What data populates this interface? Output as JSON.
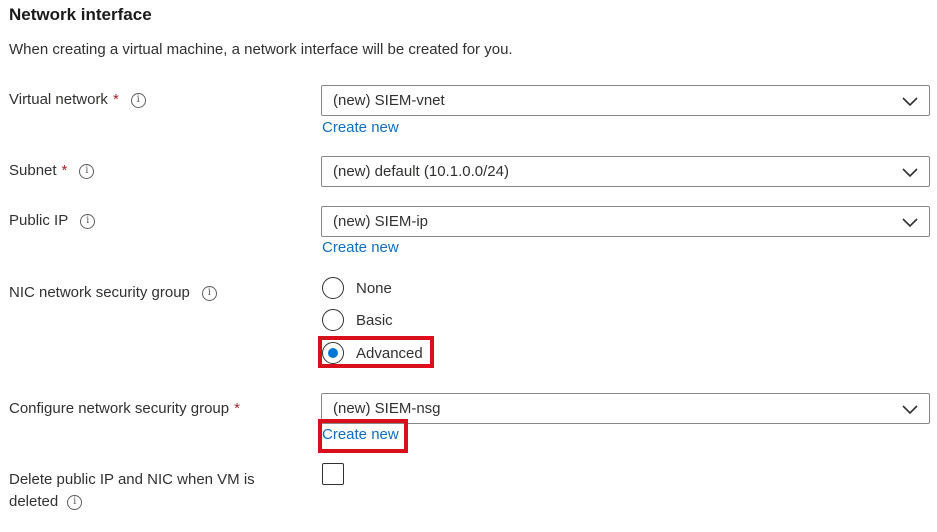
{
  "section": {
    "title": "Network interface",
    "description": "When creating a virtual machine, a network interface will be created for you."
  },
  "fields": {
    "virtual_network": {
      "label": "Virtual network",
      "required": "*",
      "value": "(new) SIEM-vnet",
      "link": "Create new"
    },
    "subnet": {
      "label": "Subnet",
      "required": "*",
      "value": "(new) default (10.1.0.0/24)"
    },
    "public_ip": {
      "label": "Public IP",
      "value": "(new) SIEM-ip",
      "link": "Create new"
    },
    "nic_nsg": {
      "label": "NIC network security group",
      "options": [
        "None",
        "Basic",
        "Advanced"
      ],
      "selected": "Advanced"
    },
    "configure_nsg": {
      "label": "Configure network security group",
      "required": "*",
      "value": "(new) SIEM-nsg",
      "link": "Create new"
    },
    "delete_public_ip": {
      "label_line1": "Delete public IP and NIC when VM is",
      "label_line2": "deleted",
      "checked": false
    }
  },
  "icons": {
    "info": "i"
  },
  "colors": {
    "link": "#106ebe",
    "required": "#a4262c",
    "radio_selected": "#0078d4",
    "highlight": "#d9101c"
  }
}
